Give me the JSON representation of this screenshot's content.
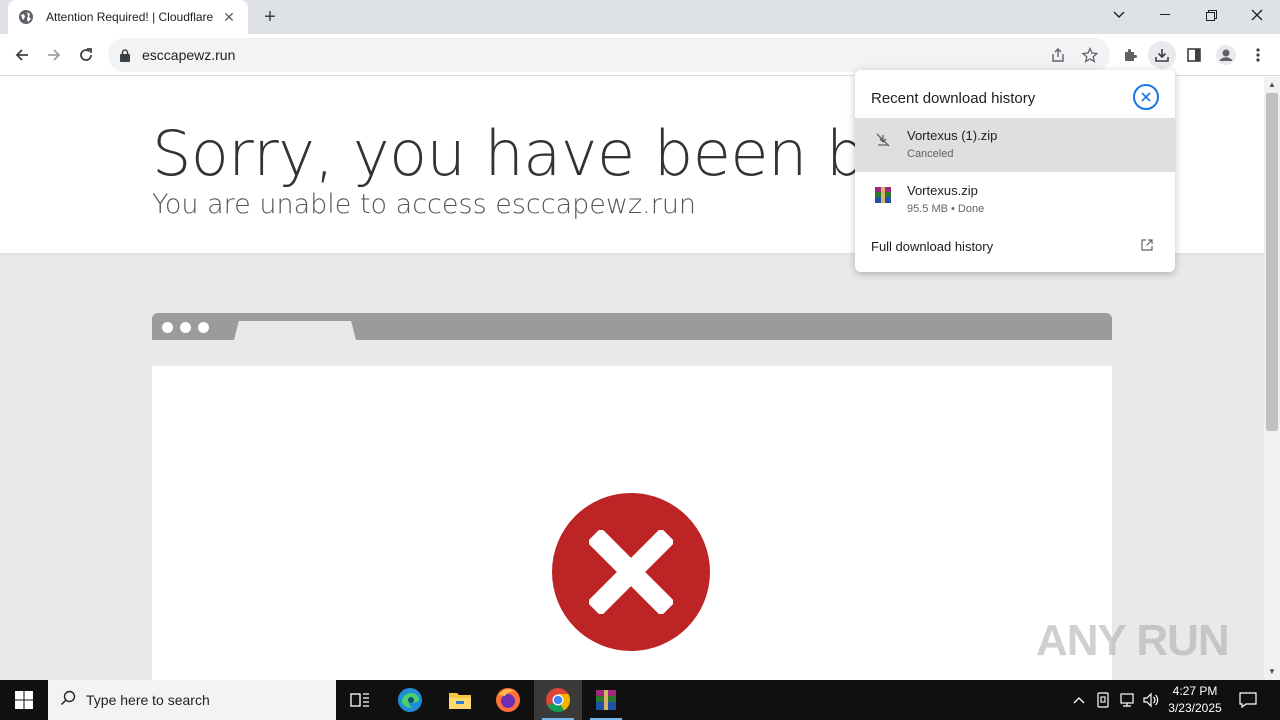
{
  "browser": {
    "tab": {
      "title": "Attention Required! | Cloudflare"
    },
    "address": {
      "url": "esccapewz.run"
    }
  },
  "page": {
    "headline": "Sorry, you have been blocked",
    "subline": "You are unable to access esccapewz.run"
  },
  "downloads": {
    "title": "Recent download history",
    "items": [
      {
        "name": "Vortexus (1).zip",
        "status": "Canceled",
        "icon": "download-off-icon"
      },
      {
        "name": "Vortexus.zip",
        "status": "95.5 MB • Done",
        "icon": "winrar-archive-icon"
      }
    ],
    "full_history": "Full download history"
  },
  "watermark": {
    "text": "ANY RUN"
  },
  "taskbar": {
    "search_placeholder": "Type here to search",
    "time": "4:27 PM",
    "date": "3/23/2025"
  },
  "colors": {
    "error_red": "#bd2426",
    "accent_blue": "#1a73e8",
    "taskbar": "#101010"
  }
}
